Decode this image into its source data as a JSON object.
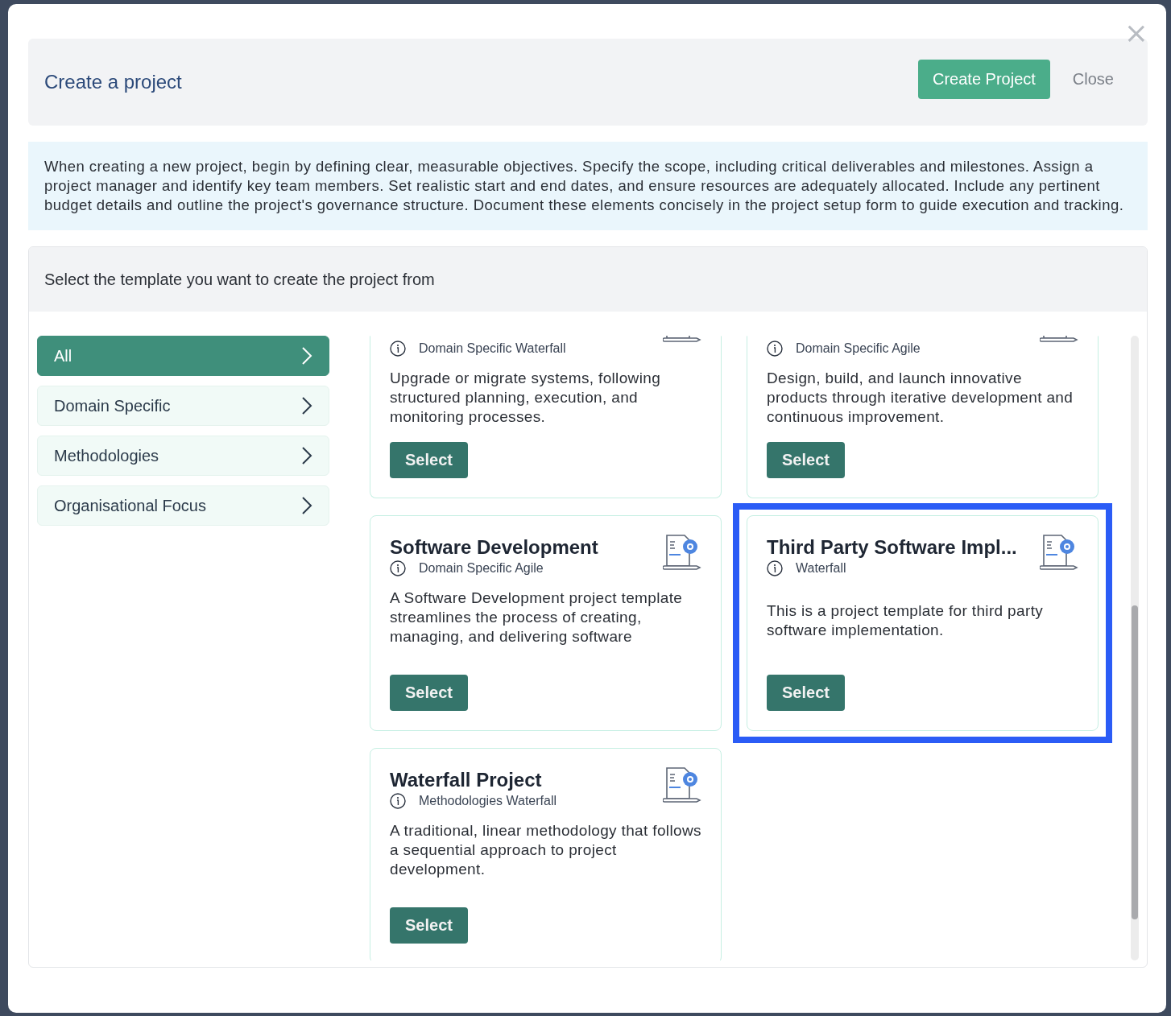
{
  "modal": {
    "close_icon": "×",
    "title": "Create a project",
    "primary_button": "Create Project",
    "secondary_button": "Close"
  },
  "intro": "When creating a new project, begin by defining clear, measurable objectives. Specify the scope, including critical deliverables and milestones. Assign a project manager and identify key team members. Set realistic start and end dates, and ensure resources are adequately allocated. Include any pertinent budget details and outline the project's governance structure. Document these elements concisely in the project setup form to guide execution and tracking.",
  "templates": {
    "heading": "Select the template you want to create the project from",
    "categories": [
      {
        "label": "All",
        "selected": true
      },
      {
        "label": "Domain Specific",
        "selected": false
      },
      {
        "label": "Methodologies",
        "selected": false
      },
      {
        "label": "Organisational Focus",
        "selected": false
      }
    ],
    "cards": [
      {
        "kind": "partial",
        "tag": "Domain Specific Waterfall",
        "description": "Upgrade or migrate systems, following structured planning, execution, and monitoring processes.",
        "button": "Select",
        "highlighted": false
      },
      {
        "kind": "partial",
        "tag": "Domain Specific Agile",
        "description": "Design, build, and launch innovative products through iterative development and continuous improvement.",
        "button": "Select",
        "highlighted": false
      },
      {
        "kind": "full",
        "title": "Software Development",
        "tag": "Domain Specific Agile",
        "description": "A Software Development project template streamlines the process of creating, managing, and delivering software",
        "button": "Select",
        "highlighted": false
      },
      {
        "kind": "full",
        "title": "Third Party Software Impl...",
        "tag": "Waterfall",
        "description": "This is a project template for third party software implementation.",
        "button": "Select",
        "highlighted": true
      },
      {
        "kind": "full",
        "title": "Waterfall Project",
        "tag": "Methodologies Waterfall",
        "description": "A traditional, linear methodology that follows a sequential approach to project development.",
        "button": "Select",
        "highlighted": false
      }
    ]
  }
}
